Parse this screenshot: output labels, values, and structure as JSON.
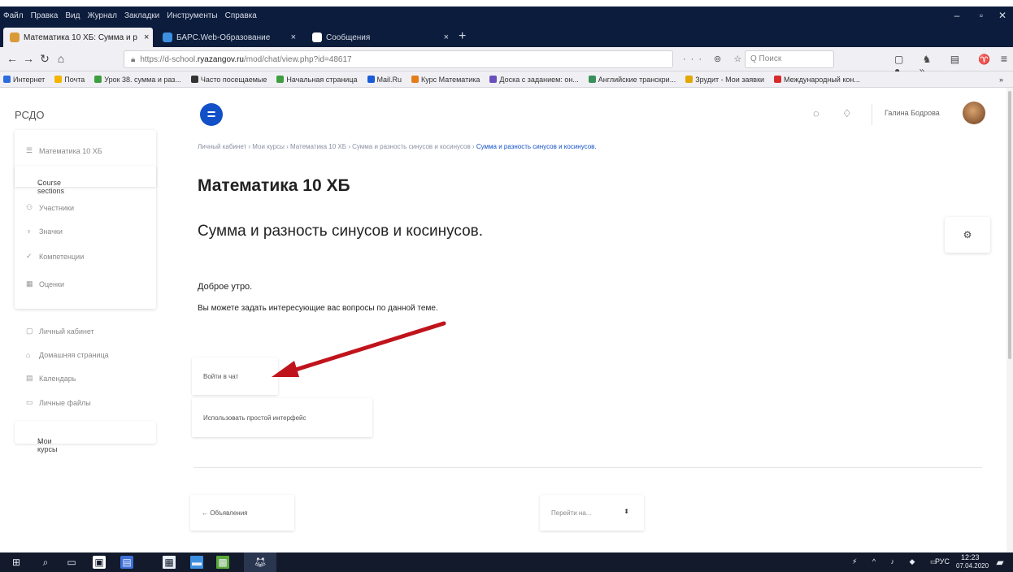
{
  "browser": {
    "menu": [
      "Файл",
      "Правка",
      "Вид",
      "Журнал",
      "Закладки",
      "Инструменты",
      "Справка"
    ],
    "tabs": [
      {
        "label": "Математика 10 ХБ: Сумма и р",
        "close": "×"
      },
      {
        "label": "БАРС.Web-Образование",
        "close": "×"
      },
      {
        "label": "Сообщения",
        "close": "×"
      }
    ],
    "new_tab": "+",
    "url_prefix": "https://d-school.",
    "url_domain": "ryazangov.ru",
    "url_path": "/mod/chat/view.php?id=48617",
    "url_icons": "··· ⊚ ☆",
    "search_placeholder": "Q Поиск",
    "ext_icons": "▢ ♞ ▤ ♈ ● »",
    "menu_icon": "≡",
    "bookmarks": [
      {
        "label": "Интернет",
        "color": "#2b6de0"
      },
      {
        "label": "Почта",
        "color": "#f4b400"
      },
      {
        "label": "Урок 38. сумма и раз...",
        "color": "#3f9e3f"
      },
      {
        "label": "Часто посещаемые",
        "color": "#333333"
      },
      {
        "label": "Начальная страница",
        "color": "#3f9e3f"
      },
      {
        "label": "Mail.Ru",
        "color": "#1a5bd6"
      },
      {
        "label": "Курс Математика",
        "color": "#e57c1a"
      },
      {
        "label": "Доска с заданием: он...",
        "color": "#6a4fbf"
      },
      {
        "label": "Английские транскри...",
        "color": "#3a8f5a"
      },
      {
        "label": "Зрудит - Мои заявки",
        "color": "#e0a800"
      },
      {
        "label": "Международный кон...",
        "color": "#d62b2b"
      }
    ],
    "bookmarks_more": "»"
  },
  "header": {
    "logo": "РСДО",
    "drawer_label": "=",
    "chat_icon": "◌",
    "bell_icon": "♢",
    "user_name": "Галина Бодрова"
  },
  "sidebar": {
    "items": [
      {
        "icon": "☰",
        "label": "Математика 10 ХБ"
      },
      {
        "icon": "⌄",
        "label": "Course sections"
      },
      {
        "icon": "⚇",
        "label": "Участники"
      },
      {
        "icon": "♆",
        "label": "Значки"
      },
      {
        "icon": "✓",
        "label": "Компетенции"
      },
      {
        "icon": "▦",
        "label": "Оценки"
      }
    ],
    "secondary": [
      {
        "icon": "▢",
        "label": "Личный кабинет"
      },
      {
        "icon": "⌂",
        "label": "Домашняя страница"
      },
      {
        "icon": "▤",
        "label": "Календарь"
      },
      {
        "icon": "▭",
        "label": "Личные файлы"
      }
    ],
    "my_courses": "Мои курсы"
  },
  "main": {
    "breadcrumb_parts": "Личный кабинет  ›  Мои курсы  ›  Математика 10 ХБ  ›  Сумма и разность синусов и косинусов  ›",
    "breadcrumb_current": "Сумма и разность синусов и косинусов.",
    "course_title": "Математика 10 ХБ",
    "section_title": "Сумма и разность синусов и косинусов.",
    "gear_icon": "⚙",
    "greeting": "Доброе утро.",
    "intro": "Вы можете задать интересующие вас вопросы по данной теме.",
    "enter_chat": "Войти в чат",
    "simple_interface": "Использовать простой интерфейс",
    "prev_link": "← Объявления",
    "jump_to": "Перейти на...",
    "jump_arrow": "⬍"
  },
  "annotation": {
    "arrow_color": "#c0141c"
  },
  "taskbar": {
    "start_icon": "⊞",
    "tray_text": "РУС",
    "time": "12:23",
    "date": "07.04.2020"
  }
}
